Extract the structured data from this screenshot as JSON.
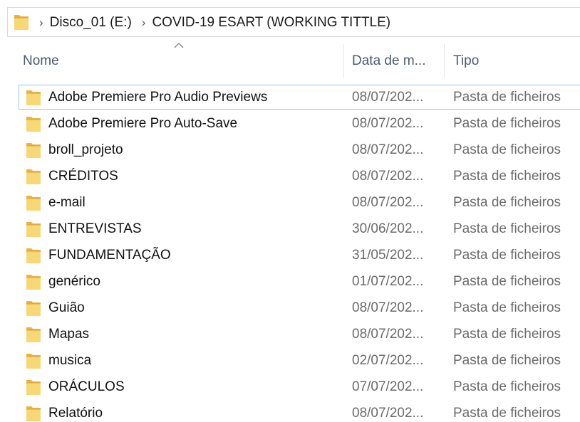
{
  "address": {
    "breadcrumbs": [
      "Disco_01 (E:)",
      "COVID-19 ESART (WORKING TITTLE)"
    ]
  },
  "columns": {
    "name": "Nome",
    "date": "Data de m...",
    "type": "Tipo"
  },
  "colors": {
    "folder_front": "#f8d775",
    "folder_back": "#e8b443",
    "focus_border": "#99c9ef",
    "header_text": "#4a5a6e",
    "secondary_text": "#6b6b6b"
  },
  "files": [
    {
      "name": "Adobe Premiere Pro Audio Previews",
      "date": "08/07/202...",
      "type": "Pasta de ficheiros"
    },
    {
      "name": "Adobe Premiere Pro Auto-Save",
      "date": "08/07/202...",
      "type": "Pasta de ficheiros"
    },
    {
      "name": "broll_projeto",
      "date": "08/07/202...",
      "type": "Pasta de ficheiros"
    },
    {
      "name": "CRÉDITOS",
      "date": "08/07/202...",
      "type": "Pasta de ficheiros"
    },
    {
      "name": "e-mail",
      "date": "08/07/202...",
      "type": "Pasta de ficheiros"
    },
    {
      "name": "ENTREVISTAS",
      "date": "30/06/202...",
      "type": "Pasta de ficheiros"
    },
    {
      "name": "FUNDAMENTAÇÃO",
      "date": "31/05/202...",
      "type": "Pasta de ficheiros"
    },
    {
      "name": "genérico",
      "date": "01/07/202...",
      "type": "Pasta de ficheiros"
    },
    {
      "name": "Guião",
      "date": "08/07/202...",
      "type": "Pasta de ficheiros"
    },
    {
      "name": "Mapas",
      "date": "08/07/202...",
      "type": "Pasta de ficheiros"
    },
    {
      "name": "musica",
      "date": "02/07/202...",
      "type": "Pasta de ficheiros"
    },
    {
      "name": "ORÁCULOS",
      "date": "07/07/202...",
      "type": "Pasta de ficheiros"
    },
    {
      "name": "Relatório",
      "date": "08/07/202...",
      "type": "Pasta de ficheiros"
    }
  ]
}
